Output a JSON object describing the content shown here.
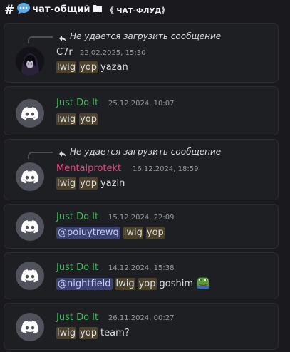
{
  "channel": {
    "hash": "#",
    "name": "чат-общий",
    "category": "《 ЧАТ-ФЛУД》",
    "bubble_icon": "speech-bubble-icon",
    "folder_icon": "folder-icon"
  },
  "reply_failed_text": "Не удается загрузить сообщение",
  "messages": [
    {
      "author": "C7r",
      "author_color": "#e0115f",
      "time": "22.02.2025, 15:30",
      "has_reply": true,
      "avatar": "anime-avatar",
      "parts": [
        {
          "text": "lwig",
          "type": "hl"
        },
        {
          "text": "yop",
          "type": "hl"
        },
        {
          "text": "yazan",
          "type": "plain"
        }
      ]
    },
    {
      "author": "Just Do It",
      "author_color": "#3fba5b",
      "time": "25.12.2024, 10:07",
      "has_reply": false,
      "avatar": "discord-avatar",
      "parts": [
        {
          "text": "lwig",
          "type": "hl"
        },
        {
          "text": "yop",
          "type": "hl"
        }
      ]
    },
    {
      "author": "Mentalprotekt",
      "author_color": "#e7467f",
      "time": "16.12.2024, 18:59",
      "has_reply": true,
      "avatar": "discord-avatar",
      "parts": [
        {
          "text": "lwig",
          "type": "hl"
        },
        {
          "text": "yop",
          "type": "hl"
        },
        {
          "text": "yazin",
          "type": "plain"
        }
      ]
    },
    {
      "author": "Just Do It",
      "author_color": "#3fba5b",
      "time": "15.12.2024, 22:09",
      "has_reply": false,
      "avatar": "discord-avatar",
      "parts": [
        {
          "text": "@poiuytrewq",
          "type": "mention"
        },
        {
          "text": "lwig",
          "type": "hl"
        },
        {
          "text": "yop",
          "type": "hl"
        }
      ]
    },
    {
      "author": "Just Do It",
      "author_color": "#3fba5b",
      "time": "14.12.2024, 15:38",
      "has_reply": false,
      "avatar": "discord-avatar",
      "parts": [
        {
          "text": "@nightfield",
          "type": "mention"
        },
        {
          "text": "lwig",
          "type": "hl"
        },
        {
          "text": "yop",
          "type": "hl"
        },
        {
          "text": "goshim",
          "type": "plain"
        }
      ],
      "emoji": "pepe-frog-emoji"
    },
    {
      "author": "Just Do It",
      "author_color": "#3fba5b",
      "time": "26.11.2024, 00:27",
      "has_reply": false,
      "avatar": "discord-avatar",
      "parts": [
        {
          "text": "lwig",
          "type": "hl"
        },
        {
          "text": "yop",
          "type": "hl"
        },
        {
          "text": "team?",
          "type": "plain"
        }
      ]
    }
  ]
}
